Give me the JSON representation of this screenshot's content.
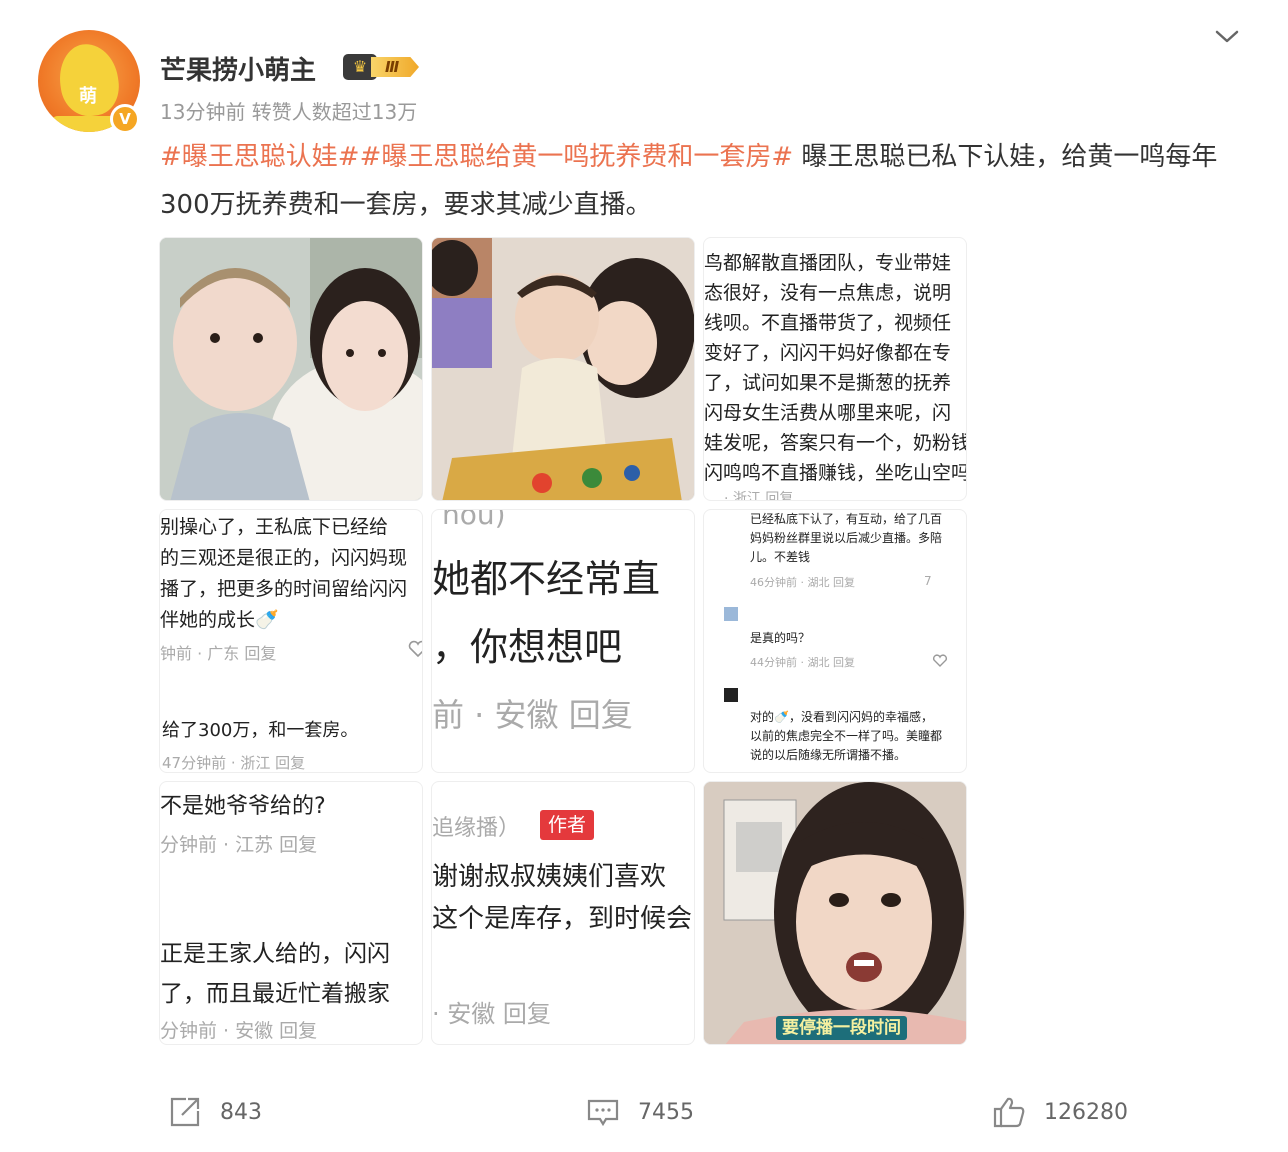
{
  "post": {
    "username": "芒果捞小萌主",
    "badge_level": "Ⅲ",
    "avatar_text": "萌",
    "meta": "13分钟前 转赞人数超过13万",
    "content": {
      "tag1": "#曝王思聪认娃#",
      "tag2": "#曝王思聪给黄一鸣抚养费和一套房#",
      "text": " 曝王思聪已私下认娃，给黄一鸣每年300万抚养费和一套房，要求其减少直播。"
    }
  },
  "images": {
    "tile3": {
      "lines": [
        "鸟都解散直播团队，专业带娃",
        "态很好，没有一点焦虑，说明",
        "线呗。不直播带货了，视频任",
        "变好了，闪闪干妈好像都在专",
        "了，试问如果不是撕葱的抚养",
        "闪母女生活费从哪里来呢，闪",
        "娃发呢，答案只有一个，奶粉钱",
        "闪鸣鸣不直播赚钱，坐吃山空吗"
      ],
      "footer": "· 浙江   回复"
    },
    "tile4": {
      "lines": [
        "别操心了，王私底下已经给",
        "的三观还是很正的，闪闪妈现",
        "播了，把更多的时间留给闪闪",
        "伴她的成长🍼"
      ],
      "meta1": "钟前 · 广东   回复",
      "reply": "给了300万，和一套房。",
      "meta2": "47分钟前 · 浙江   回复"
    },
    "tile5": {
      "top": "hou)",
      "line1": "她都不经常直",
      "line2": "，你想想吧",
      "meta": "前 · 安徽   回复"
    },
    "tile6": {
      "c1": [
        "已经私底下认了，有互动，给了几百",
        "妈妈粉丝群里说以后减少直播。多陪",
        "儿。不差钱"
      ],
      "m1": "46分钟前 · 湖北   回复",
      "c2": "是真的吗？",
      "m2": "44分钟前 · 湖北   回复",
      "c3": [
        "对的🍼，没看到闪闪妈的幸福感，",
        "以前的焦虑完全不一样了吗。美瞳都",
        "说的以后随缘无所谓播不播。"
      ],
      "like1": "7"
    },
    "tile7": {
      "l1": "不是她爷爷给的?",
      "m1": "分钟前 · 江苏   回复",
      "l2": "正是王家人给的，闪闪",
      "l3": "了，而且最近忙着搬家",
      "m2": "分钟前 · 安徽   回复"
    },
    "tile8": {
      "top": "追缘播）",
      "author_tag": "作者",
      "l1": "谢谢叔叔姨姨们喜欢",
      "l2": "这个是库存，到时候会",
      "meta": "· 安徽   回复"
    },
    "tile9": {
      "caption": "要停播一段时间"
    }
  },
  "actions": {
    "share_count": "843",
    "comment_count": "7455",
    "like_count": "126280"
  },
  "colors": {
    "tag": "#eb7350",
    "meta": "#999999",
    "avatar_bg": "#f07a28"
  }
}
